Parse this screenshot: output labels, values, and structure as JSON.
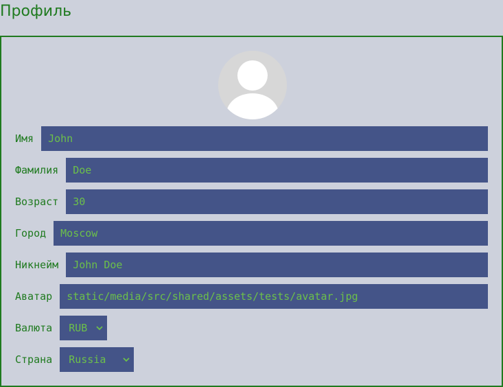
{
  "page": {
    "title": "Профиль"
  },
  "profile": {
    "avatar_icon": "user-silhouette-icon",
    "fields": {
      "first_name": {
        "label": "Имя",
        "value": "John"
      },
      "last_name": {
        "label": "Фамилия",
        "value": "Doe"
      },
      "age": {
        "label": "Возраст",
        "value": "30"
      },
      "city": {
        "label": "Город",
        "value": "Moscow"
      },
      "username": {
        "label": "Никнейм",
        "value": "John Doe"
      },
      "avatar": {
        "label": "Аватар",
        "value": "static/media/src/shared/assets/tests/avatar.jpg"
      }
    },
    "selects": {
      "currency": {
        "label": "Валюта",
        "value": "RUB"
      },
      "country": {
        "label": "Страна",
        "value": "Russia"
      }
    }
  },
  "colors": {
    "background": "#cdd1dc",
    "accent": "#1f7a1f",
    "input_bg": "#445488",
    "input_text": "#6cc04a"
  }
}
